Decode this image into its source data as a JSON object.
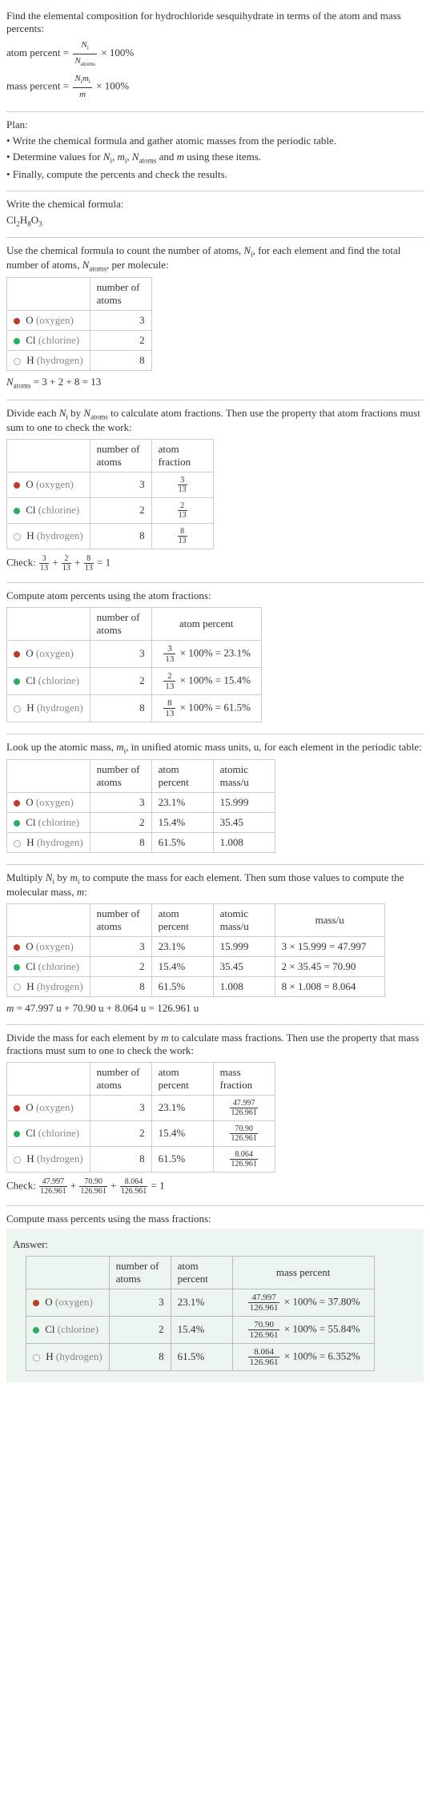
{
  "intro": {
    "title": "Find the elemental composition for hydrochloride sesquihydrate in terms of the atom and mass percents:",
    "atom_percent_label": "atom percent = ",
    "atom_percent_frac_num": "N",
    "atom_percent_frac_num_sub": "i",
    "atom_percent_frac_den": "N",
    "atom_percent_frac_den_sub": "atoms",
    "atom_percent_tail": " × 100%",
    "mass_percent_label": "mass percent = ",
    "mass_percent_frac_num": "N",
    "mass_percent_frac_num_sub": "i",
    "mass_percent_frac_num2": "m",
    "mass_percent_frac_num2_sub": "i",
    "mass_percent_frac_den": "m",
    "mass_percent_tail": " × 100%"
  },
  "plan": {
    "title": "Plan:",
    "b1": "Write the chemical formula and gather atomic masses from the periodic table.",
    "b2a": "Determine values for ",
    "b2b": " using these items.",
    "b3": "Finally, compute the percents and check the results."
  },
  "chemformula": {
    "title": "Write the chemical formula:",
    "formula": "Cl",
    "s1": "2",
    "f2": "H",
    "s2": "8",
    "f3": "O",
    "s3": "3"
  },
  "count": {
    "title_a": "Use the chemical formula to count the number of atoms, ",
    "title_b": ", for each element and find the total number of atoms, ",
    "title_c": ", per molecule:",
    "col1": "number of atoms",
    "rows": [
      {
        "dot": "red",
        "el": "O",
        "name": "(oxygen)",
        "n": "3"
      },
      {
        "dot": "green",
        "el": "Cl",
        "name": "(chlorine)",
        "n": "2"
      },
      {
        "dot": "white",
        "el": "H",
        "name": "(hydrogen)",
        "n": "8"
      }
    ],
    "sum_label": " = 3 + 2 + 8 = 13"
  },
  "atomfrac": {
    "title_a": "Divide each ",
    "title_b": " by ",
    "title_c": " to calculate atom fractions. Then use the property that atom fractions must sum to one to check the work:",
    "col1": "number of atoms",
    "col2": "atom fraction",
    "rows": [
      {
        "dot": "red",
        "el": "O",
        "name": "(oxygen)",
        "n": "3",
        "num": "3",
        "den": "13"
      },
      {
        "dot": "green",
        "el": "Cl",
        "name": "(chlorine)",
        "n": "2",
        "num": "2",
        "den": "13"
      },
      {
        "dot": "white",
        "el": "H",
        "name": "(hydrogen)",
        "n": "8",
        "num": "8",
        "den": "13"
      }
    ],
    "check_label": "Check: ",
    "check_eq": " = 1"
  },
  "atompct": {
    "title": "Compute atom percents using the atom fractions:",
    "col1": "number of atoms",
    "col2": "atom percent",
    "rows": [
      {
        "dot": "red",
        "el": "O",
        "name": "(oxygen)",
        "n": "3",
        "num": "3",
        "den": "13",
        "pct": "23.1%"
      },
      {
        "dot": "green",
        "el": "Cl",
        "name": "(chlorine)",
        "n": "2",
        "num": "2",
        "den": "13",
        "pct": "15.4%"
      },
      {
        "dot": "white",
        "el": "H",
        "name": "(hydrogen)",
        "n": "8",
        "num": "8",
        "den": "13",
        "pct": "61.5%"
      }
    ]
  },
  "atomicmass": {
    "title_a": "Look up the atomic mass, ",
    "title_b": ", in unified atomic mass units, u, for each element in the periodic table:",
    "col1": "number of atoms",
    "col2": "atom percent",
    "col3": "atomic mass/u",
    "rows": [
      {
        "dot": "red",
        "el": "O",
        "name": "(oxygen)",
        "n": "3",
        "pct": "23.1%",
        "m": "15.999"
      },
      {
        "dot": "green",
        "el": "Cl",
        "name": "(chlorine)",
        "n": "2",
        "pct": "15.4%",
        "m": "35.45"
      },
      {
        "dot": "white",
        "el": "H",
        "name": "(hydrogen)",
        "n": "8",
        "pct": "61.5%",
        "m": "1.008"
      }
    ]
  },
  "masscalc": {
    "title_a": "Multiply ",
    "title_b": " by ",
    "title_c": " to compute the mass for each element. Then sum those values to compute the molecular mass, ",
    "title_d": ":",
    "col1": "number of atoms",
    "col2": "atom percent",
    "col3": "atomic mass/u",
    "col4": "mass/u",
    "rows": [
      {
        "dot": "red",
        "el": "O",
        "name": "(oxygen)",
        "n": "3",
        "pct": "23.1%",
        "m": "15.999",
        "calc": "3 × 15.999 = 47.997"
      },
      {
        "dot": "green",
        "el": "Cl",
        "name": "(chlorine)",
        "n": "2",
        "pct": "15.4%",
        "m": "35.45",
        "calc": "2 × 35.45 = 70.90"
      },
      {
        "dot": "white",
        "el": "H",
        "name": "(hydrogen)",
        "n": "8",
        "pct": "61.5%",
        "m": "1.008",
        "calc": "8 × 1.008 = 8.064"
      }
    ],
    "sum": " = 47.997 u + 70.90 u + 8.064 u = 126.961 u"
  },
  "massfrac": {
    "title_a": "Divide the mass for each element by ",
    "title_b": " to calculate mass fractions. Then use the property that mass fractions must sum to one to check the work:",
    "col1": "number of atoms",
    "col2": "atom percent",
    "col3": "mass fraction",
    "rows": [
      {
        "dot": "red",
        "el": "O",
        "name": "(oxygen)",
        "n": "3",
        "pct": "23.1%",
        "num": "47.997",
        "den": "126.961"
      },
      {
        "dot": "green",
        "el": "Cl",
        "name": "(chlorine)",
        "n": "2",
        "pct": "15.4%",
        "num": "70.90",
        "den": "126.961"
      },
      {
        "dot": "white",
        "el": "H",
        "name": "(hydrogen)",
        "n": "8",
        "pct": "61.5%",
        "num": "8.064",
        "den": "126.961"
      }
    ],
    "check_label": "Check: ",
    "check_eq": " = 1"
  },
  "masspct": {
    "title": "Compute mass percents using the mass fractions:",
    "answer_label": "Answer:",
    "col1": "number of atoms",
    "col2": "atom percent",
    "col3": "mass percent",
    "rows": [
      {
        "dot": "red",
        "el": "O",
        "name": "(oxygen)",
        "n": "3",
        "pct": "23.1%",
        "num": "47.997",
        "den": "126.961",
        "res": "37.80%"
      },
      {
        "dot": "green",
        "el": "Cl",
        "name": "(chlorine)",
        "n": "2",
        "pct": "15.4%",
        "num": "70.90",
        "den": "126.961",
        "res": "55.84%"
      },
      {
        "dot": "white",
        "el": "H",
        "name": "(hydrogen)",
        "n": "8",
        "pct": "61.5%",
        "num": "8.064",
        "den": "126.961",
        "res": "6.352%"
      }
    ]
  },
  "chart_data": {
    "type": "table",
    "title": "Elemental composition of Cl2H8O3",
    "elements": [
      {
        "element": "O (oxygen)",
        "number_of_atoms": 3,
        "atom_fraction": "3/13",
        "atom_percent": 23.1,
        "atomic_mass_u": 15.999,
        "mass_u": 47.997,
        "mass_fraction": "47.997/126.961",
        "mass_percent": 37.8
      },
      {
        "element": "Cl (chlorine)",
        "number_of_atoms": 2,
        "atom_fraction": "2/13",
        "atom_percent": 15.4,
        "atomic_mass_u": 35.45,
        "mass_u": 70.9,
        "mass_fraction": "70.90/126.961",
        "mass_percent": 55.84
      },
      {
        "element": "H (hydrogen)",
        "number_of_atoms": 8,
        "atom_fraction": "8/13",
        "atom_percent": 61.5,
        "atomic_mass_u": 1.008,
        "mass_u": 8.064,
        "mass_fraction": "8.064/126.961",
        "mass_percent": 6.352
      }
    ],
    "N_atoms": 13,
    "molecular_mass_u": 126.961
  }
}
